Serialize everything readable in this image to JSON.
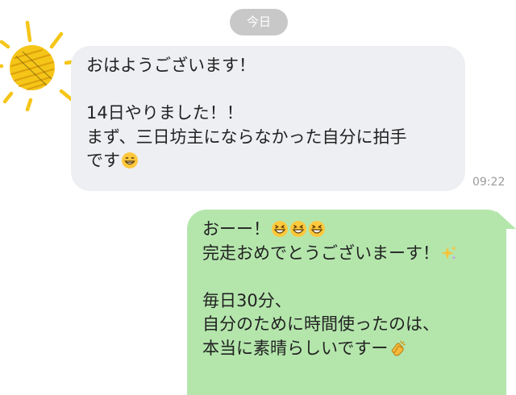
{
  "date_separator": "今日",
  "incoming": {
    "lines": [
      "おはようございます！",
      "",
      "14日やりました！！",
      "まず、三日坊主にならなかった自分に拍手",
      "です"
    ],
    "time": "09:22",
    "trailing_emoji": "grinning-face-icon"
  },
  "outgoing": {
    "lines": [
      "おーー！",
      "完走おめでとうございまーす！",
      "",
      "毎日30分、",
      "自分のために時間使ったのは、",
      "本当に素晴らしいですー"
    ],
    "emojis": {
      "line1": [
        "grinning-squinting-face-icon",
        "grinning-squinting-face-icon",
        "grinning-squinting-face-icon"
      ],
      "line2": "sparkles-icon",
      "line6": "clapping-hands-icon"
    }
  },
  "colors": {
    "incoming_bubble": "#eeeff3",
    "outgoing_bubble": "#b4e6ac",
    "date_pill": "#c8c8c8",
    "sun": "#f5c518"
  }
}
